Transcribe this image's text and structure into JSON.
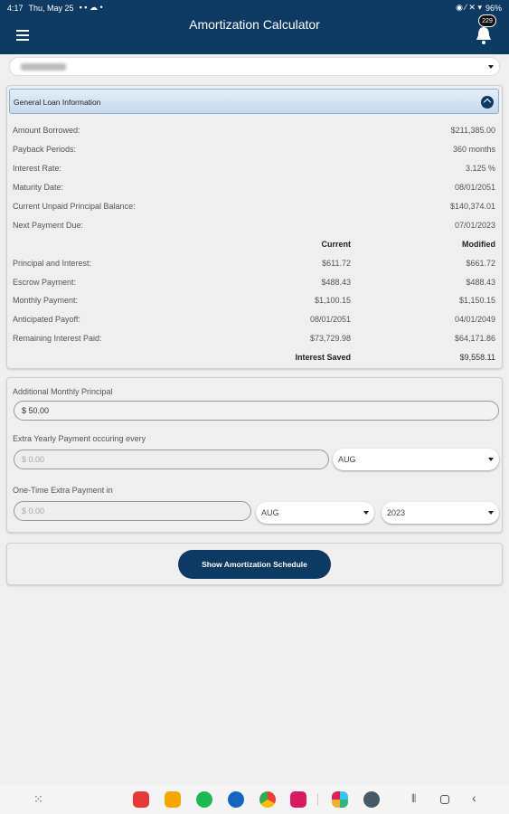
{
  "status": {
    "time": "4:17",
    "date": "Thu, May 25",
    "battery": "96%"
  },
  "header": {
    "title": "Amortization Calculator",
    "badge": "229"
  },
  "section": {
    "title": "General Loan Information"
  },
  "info": [
    {
      "label": "Amount Borrowed:",
      "value": "$211,385.00"
    },
    {
      "label": "Payback Periods:",
      "value": "360 months"
    },
    {
      "label": "Interest Rate:",
      "value": "3.125 %"
    },
    {
      "label": "Maturity Date:",
      "value": "08/01/2051"
    },
    {
      "label": "Current Unpaid Principal Balance:",
      "value": "$140,374.01"
    },
    {
      "label": "Next Payment Due:",
      "value": "07/01/2023"
    }
  ],
  "cols": {
    "current": "Current",
    "modified": "Modified"
  },
  "compare": [
    {
      "label": "Principal and Interest:",
      "current": "$611.72",
      "modified": "$661.72"
    },
    {
      "label": "Escrow Payment:",
      "current": "$488.43",
      "modified": "$488.43"
    },
    {
      "label": "Monthly Payment:",
      "current": "$1,100.15",
      "modified": "$1,150.15"
    },
    {
      "label": "Anticipated Payoff:",
      "current": "08/01/2051",
      "modified": "04/01/2049"
    },
    {
      "label": "Remaining Interest Paid:",
      "current": "$73,729.98",
      "modified": "$64,171.86"
    }
  ],
  "saved": {
    "label": "Interest Saved",
    "value": "$9,558.11"
  },
  "form": {
    "additional_label": "Additional Monthly Principal",
    "additional_value": "$ 50.00",
    "yearly_label": "Extra Yearly Payment occuring every",
    "yearly_value": "$ 0.00",
    "yearly_month": "AUG",
    "onetime_label": "One-Time Extra Payment in",
    "onetime_value": "$ 0.00",
    "onetime_month": "AUG",
    "onetime_year": "2023"
  },
  "button": {
    "label": "Show Amortization Schedule"
  }
}
